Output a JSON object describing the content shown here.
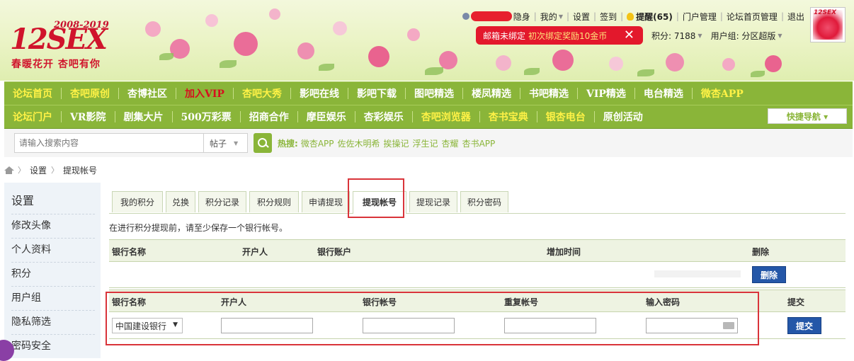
{
  "logo": {
    "years": "2008-2019",
    "name": "12SEX",
    "slogan": "春暖花开 杏吧有你"
  },
  "topbar": {
    "links": [
      "隐身",
      "我的",
      "设置",
      "签到"
    ],
    "remind_label": "提醒(65)",
    "links2": [
      "门户管理",
      "论坛首页管理",
      "退出"
    ]
  },
  "avatar": {
    "tag": "12SEX"
  },
  "bind_banner": {
    "text": "邮箱未绑定",
    "highlight": "初次绑定奖励10金币",
    "close": "✕"
  },
  "info": {
    "points": "积分: 7188",
    "usergroup": "用户组: 分区超版"
  },
  "nav1": [
    {
      "label": "论坛首页",
      "style": "yellow"
    },
    {
      "label": "杏吧原创",
      "style": "yellow"
    },
    {
      "label": "杏博社区",
      "style": "white"
    },
    {
      "label": "加入VIP",
      "style": "red"
    },
    {
      "label": "杏吧大秀",
      "style": "yellow"
    },
    {
      "label": "影吧在线",
      "style": "white"
    },
    {
      "label": "影吧下载",
      "style": "white"
    },
    {
      "label": "图吧精选",
      "style": "white"
    },
    {
      "label": "楼凤精选",
      "style": "white"
    },
    {
      "label": "书吧精选",
      "style": "white"
    },
    {
      "label": "VIP精选",
      "style": "white"
    },
    {
      "label": "电台精选",
      "style": "white"
    },
    {
      "label": "微杏APP",
      "style": "yellow"
    }
  ],
  "nav2": [
    {
      "label": "论坛门户",
      "style": "yellow"
    },
    {
      "label": "VR影院",
      "style": "white"
    },
    {
      "label": "剧集大片",
      "style": "white"
    },
    {
      "label": "500万彩票",
      "style": "white"
    },
    {
      "label": "招商合作",
      "style": "white"
    },
    {
      "label": "摩臣娱乐",
      "style": "white"
    },
    {
      "label": "杏彩娱乐",
      "style": "white"
    },
    {
      "label": "杏吧浏览器",
      "style": "yellow"
    },
    {
      "label": "杏书宝典",
      "style": "yellow"
    },
    {
      "label": "银杏电台",
      "style": "yellow"
    },
    {
      "label": "原创活动",
      "style": "white"
    }
  ],
  "quicknav": "快捷导航 ▾",
  "search": {
    "placeholder": "请输入搜索内容",
    "type": "帖子",
    "hot_label": "热搜:",
    "hot": [
      "微杏APP",
      "佐佐木明希",
      "挨操记",
      "浮生记",
      "杏耀",
      "杏书APP"
    ]
  },
  "breadcrumb": [
    "设置",
    "提现帐号"
  ],
  "sidebar": {
    "title": "设置",
    "items": [
      "修改头像",
      "个人资料",
      "积分",
      "用户组",
      "隐私筛选",
      "密码安全"
    ]
  },
  "tabs": [
    {
      "label": "我的积分",
      "active": false
    },
    {
      "label": "兑换",
      "active": false
    },
    {
      "label": "积分记录",
      "active": false
    },
    {
      "label": "积分规则",
      "active": false
    },
    {
      "label": "申请提现",
      "active": false
    },
    {
      "label": "提现帐号",
      "active": true
    },
    {
      "label": "提现记录",
      "active": false
    },
    {
      "label": "积分密码",
      "active": false
    }
  ],
  "notice": "在进行积分提现前，请至少保存一个银行帐号。",
  "accounts_table": {
    "headers": [
      "银行名称",
      "开户人",
      "银行账户",
      "增加时间",
      "删除"
    ],
    "delete_label": "删除"
  },
  "add_form": {
    "headers": [
      "银行名称",
      "开户人",
      "银行帐号",
      "重复帐号",
      "输入密码",
      "提交"
    ],
    "bank_selected": "中国建设银行",
    "submit_label": "提交"
  },
  "colors": {
    "nav_green": "#8ab539",
    "button_blue": "#2457a8",
    "highlight_red": "#d9343a"
  }
}
